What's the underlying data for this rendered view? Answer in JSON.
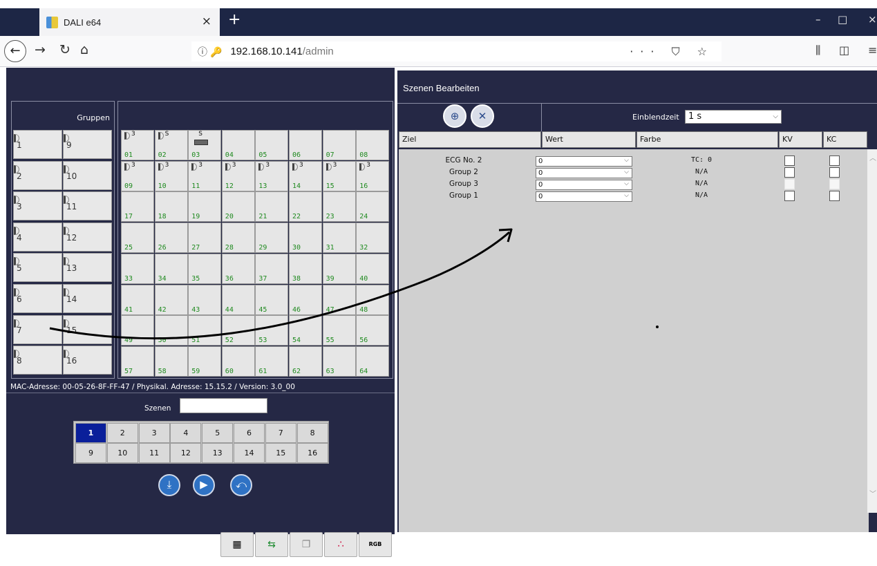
{
  "browser": {
    "tab_title": "DALI e64",
    "tab_close": "×",
    "new_tab": "+",
    "url_host": "192.168.10.141",
    "url_path": "/admin",
    "url_icons": "ⓘ🔑",
    "page_actions": "··· ⛉ ☆",
    "window_controls": {
      "minimize": "–",
      "maximize": "□",
      "close": "×"
    }
  },
  "groups": {
    "header": "Gruppen",
    "items": [
      "1",
      "2",
      "3",
      "4",
      "5",
      "6",
      "7",
      "8",
      "9",
      "10",
      "11",
      "12",
      "13",
      "14",
      "15",
      "16"
    ]
  },
  "ecg": {
    "numbers": [
      "01",
      "02",
      "03",
      "04",
      "05",
      "06",
      "07",
      "08",
      "09",
      "10",
      "11",
      "12",
      "13",
      "14",
      "15",
      "16",
      "17",
      "18",
      "19",
      "20",
      "21",
      "22",
      "23",
      "24",
      "25",
      "26",
      "27",
      "28",
      "29",
      "30",
      "31",
      "32",
      "33",
      "34",
      "35",
      "36",
      "37",
      "38",
      "39",
      "40",
      "41",
      "42",
      "43",
      "44",
      "45",
      "46",
      "47",
      "48",
      "49",
      "50",
      "51",
      "52",
      "53",
      "54",
      "55",
      "56",
      "57",
      "58",
      "59",
      "60",
      "61",
      "62",
      "63",
      "64"
    ],
    "tags": {
      "01": "3",
      "02": "S",
      "03": "S",
      "09": "3",
      "10": "3",
      "11": "3",
      "12": "3",
      "13": "3",
      "14": "3",
      "15": "3",
      "16": "3"
    }
  },
  "status": {
    "mac_line": "MAC-Adresse: 00-05-26-8F-FF-47 / Physikal. Adresse: 15.15.2 / Version: 3.0_00"
  },
  "scenes": {
    "label": "Szenen",
    "input_value": "",
    "items": [
      "1",
      "2",
      "3",
      "4",
      "5",
      "6",
      "7",
      "8",
      "9",
      "10",
      "11",
      "12",
      "13",
      "14",
      "15",
      "16"
    ],
    "active": "1"
  },
  "editor": {
    "title": "Szenen Bearbeiten",
    "fade_label": "Einblendzeit",
    "fade_value": "1 s",
    "columns": [
      "Ziel",
      "Wert",
      "Farbe",
      "KV",
      "KC"
    ],
    "rows": [
      {
        "target": "ECG No. 2",
        "value": "0",
        "color": "TC: 0",
        "kv_enabled": true,
        "kc_enabled": true
      },
      {
        "target": "Group 2",
        "value": "0",
        "color": "N/A",
        "kv_enabled": true,
        "kc_enabled": true
      },
      {
        "target": "Group 3",
        "value": "0",
        "color": "N/A",
        "kv_enabled": false,
        "kc_enabled": false
      },
      {
        "target": "Group 1",
        "value": "0",
        "color": "N/A",
        "kv_enabled": true,
        "kc_enabled": true
      }
    ]
  },
  "bottom_icons": [
    "table-icon",
    "swap-arrows-icon",
    "copy-icon",
    "color-dots-icon",
    "rgb-icon"
  ],
  "rgb_text": "RGB"
}
